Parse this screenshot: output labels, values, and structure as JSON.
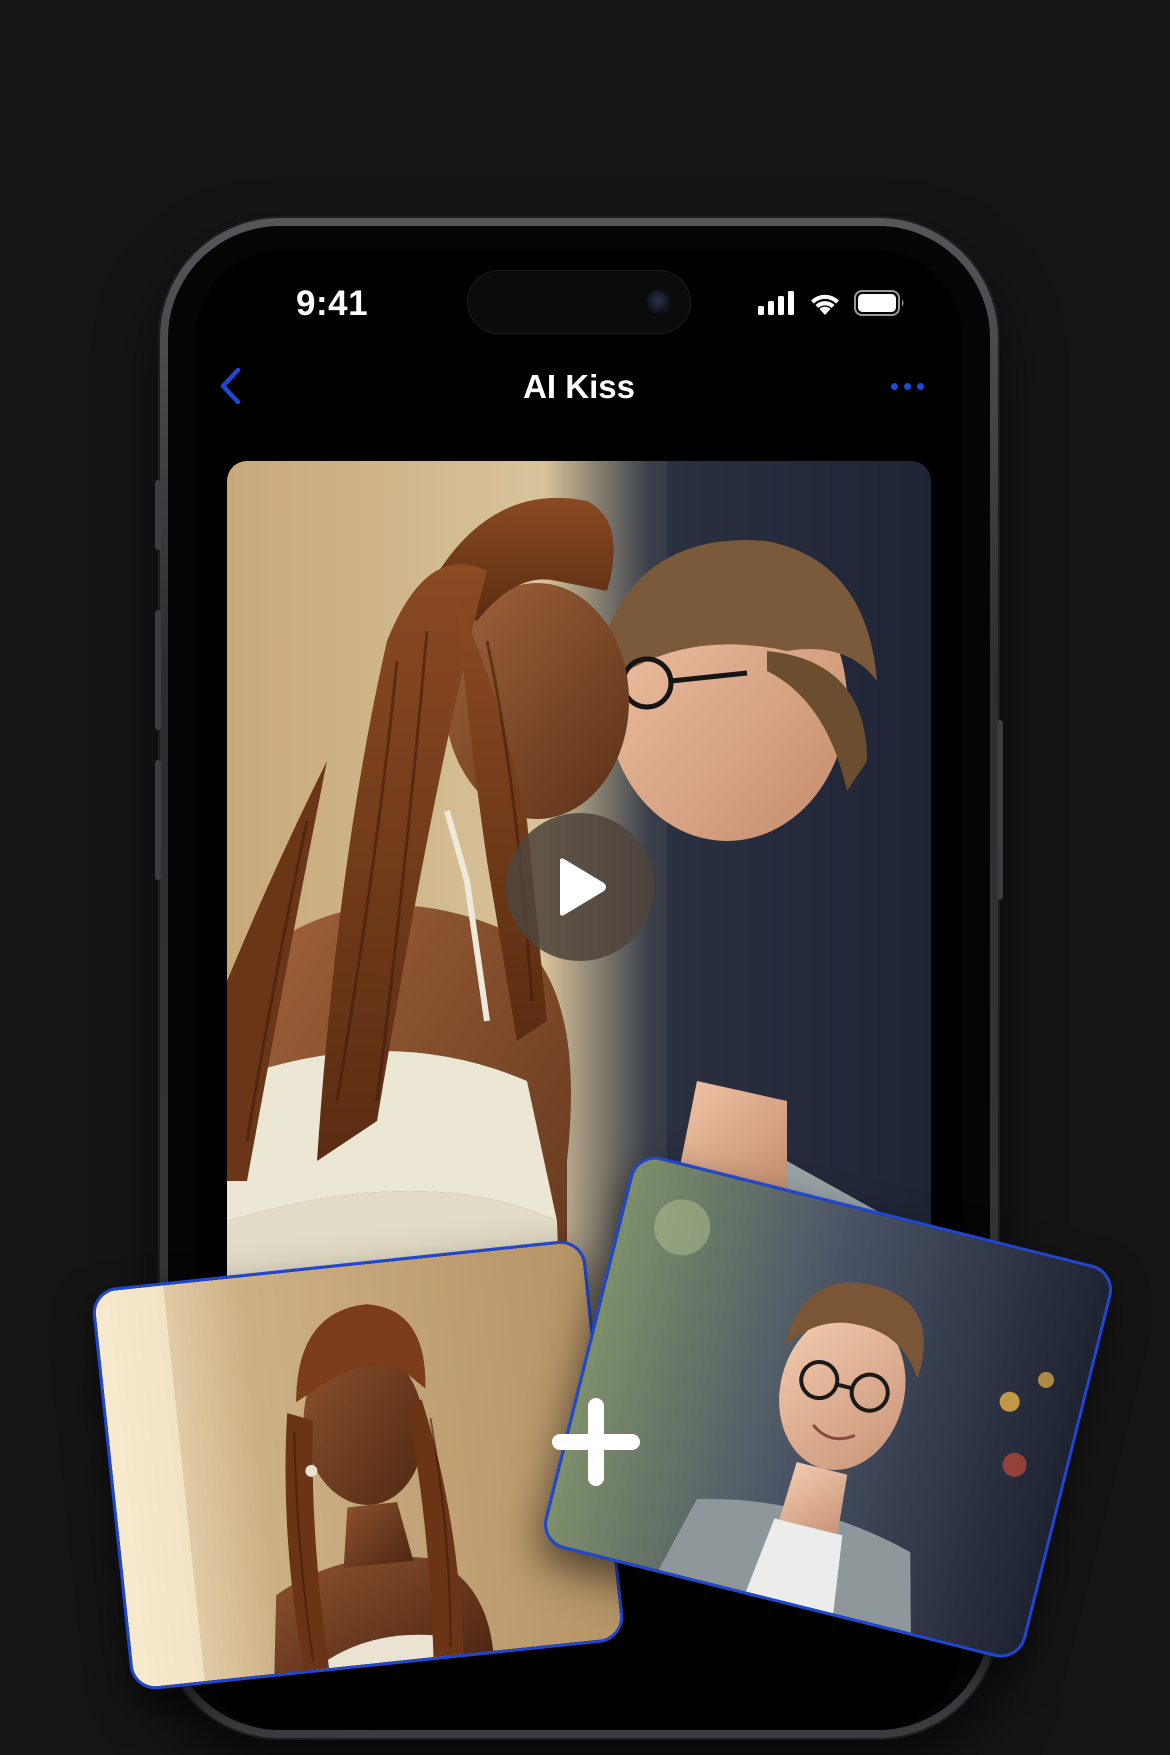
{
  "status_bar": {
    "time": "9:41"
  },
  "nav": {
    "title": "AI Kiss",
    "back_icon": "chevron-left-icon",
    "more_icon": "ellipsis-icon"
  },
  "video": {
    "play_icon": "play-icon"
  },
  "composer": {
    "plus_icon": "plus-icon"
  },
  "colors": {
    "background": "#151516",
    "accent": "#1c49d6",
    "card_border": "#1f47d2",
    "title": "#ffffff"
  }
}
